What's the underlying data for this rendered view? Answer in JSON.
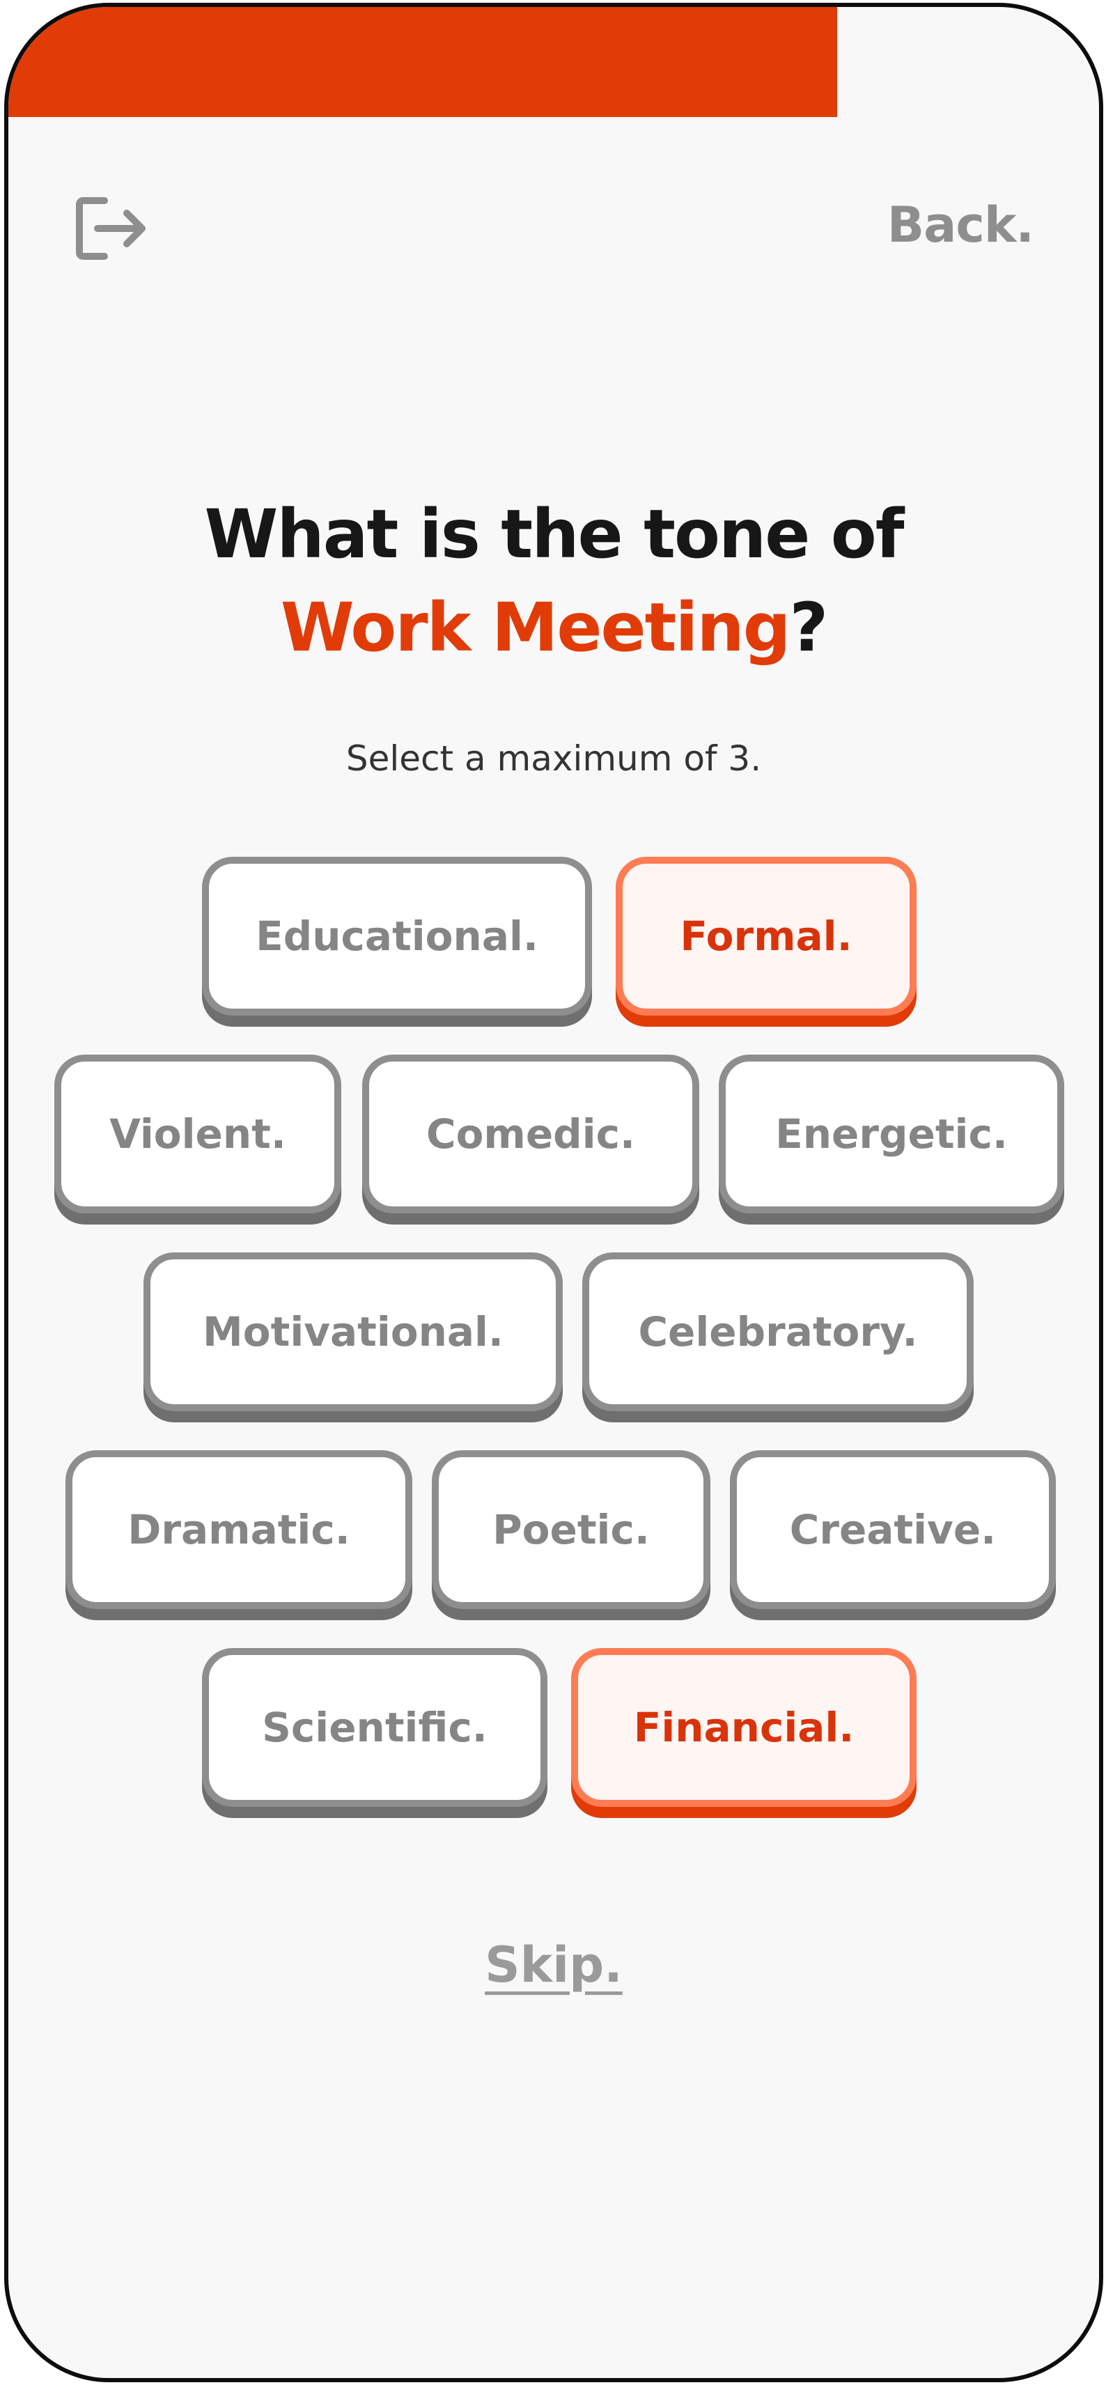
{
  "progress": {
    "fraction": 0.76,
    "color": "#e13c08"
  },
  "header": {
    "exit_icon": "exit-door-arrow-icon",
    "back_label": "Back."
  },
  "question": {
    "prefix": "What is the tone of",
    "subject": "Work Meeting",
    "suffix": "?"
  },
  "subtitle": "Select a maximum of 3.",
  "options": [
    {
      "label": "Educational.",
      "selected": false
    },
    {
      "label": "Formal.",
      "selected": true
    },
    {
      "label": "Violent.",
      "selected": false
    },
    {
      "label": "Comedic.",
      "selected": false
    },
    {
      "label": "Energetic.",
      "selected": false
    },
    {
      "label": "Motivational.",
      "selected": false
    },
    {
      "label": "Celebratory.",
      "selected": false
    },
    {
      "label": "Dramatic.",
      "selected": false
    },
    {
      "label": "Poetic.",
      "selected": false
    },
    {
      "label": "Creative.",
      "selected": false
    },
    {
      "label": "Scientific.",
      "selected": false
    },
    {
      "label": "Financial.",
      "selected": true
    }
  ],
  "skip_label": "Skip.",
  "colors": {
    "accent": "#e13c08",
    "chip_border": "#8e8e8e",
    "chip_selected_border": "#fd7c54"
  }
}
